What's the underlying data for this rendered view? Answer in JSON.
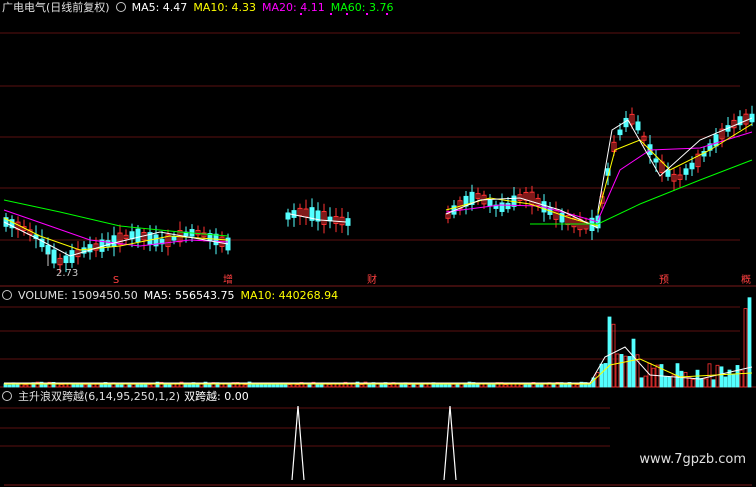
{
  "colors": {
    "grid": "#5a0f0f",
    "up": "#ff3232",
    "down": "#54ffff",
    "ma5": "#ffffff",
    "ma10": "#ffff00",
    "ma20": "#ff00ff",
    "ma60": "#00ff00",
    "signal": "#ffffff",
    "marker": "#ff4040"
  },
  "main_panel": {
    "title": "广电电气(日线前复权)",
    "ma5": "MA5: 4.47",
    "ma10": "MA10: 4.33",
    "ma20": "MA20: 4.11",
    "ma60": "MA60: 3.76",
    "low_label": "2.73",
    "markers": [
      "S",
      "增",
      "财",
      "预",
      "概"
    ]
  },
  "volume_panel": {
    "volume": "VOLUME: 1509450.50",
    "ma5": "MA5: 556543.75",
    "ma10": "MA10: 440268.94"
  },
  "indicator_panel": {
    "name": "主升浪双跨越(6,14,95,250,1,2)",
    "value": "双跨越: 0.00"
  },
  "watermark": "www.7gpzb.com"
}
